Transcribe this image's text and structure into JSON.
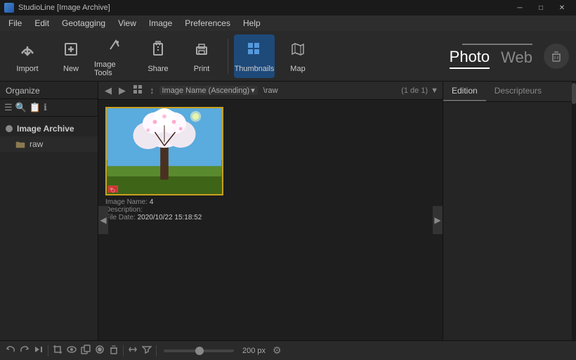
{
  "titlebar": {
    "title": "StudioLine [Image Archive]",
    "icon": "app-icon",
    "controls": {
      "minimize": "─",
      "maximize": "□",
      "close": "✕"
    }
  },
  "menubar": {
    "items": [
      "File",
      "Edit",
      "Geotagging",
      "View",
      "Image",
      "Preferences",
      "Help"
    ]
  },
  "toolbar": {
    "tools": [
      {
        "id": "import",
        "label": "Import",
        "icon": "↩"
      },
      {
        "id": "new",
        "label": "New",
        "icon": "+"
      },
      {
        "id": "image-tools",
        "label": "Image Tools",
        "icon": "✏"
      },
      {
        "id": "share",
        "label": "Share",
        "icon": "⬆"
      },
      {
        "id": "print",
        "label": "Print",
        "icon": "🖨"
      },
      {
        "id": "thumbnails",
        "label": "Thumbnails",
        "icon": "⊞",
        "active": true
      },
      {
        "id": "map",
        "label": "Map",
        "icon": "🗺"
      }
    ],
    "view_tabs": {
      "photo": "Photo",
      "web": "Web"
    },
    "trash_label": "🗑"
  },
  "sidebar": {
    "header": "Organize",
    "tools": [
      "☰",
      "🔍",
      "📋",
      "ℹ"
    ],
    "tree": {
      "root": {
        "label": "Image Archive",
        "icon": "●"
      },
      "children": [
        {
          "label": "raw",
          "icon": "📁"
        }
      ]
    }
  },
  "filterbar": {
    "nav_back": "◀",
    "nav_forward": "▶",
    "view_mode": "⊞",
    "sort_icon": "↕",
    "sort_label": "Image Name (Ascending)",
    "path": "\\raw",
    "count": "(1 de 1)",
    "dropdown_icon": "▼"
  },
  "thumbnail": {
    "border_color": "#c8a020",
    "tag_icon": "🏷",
    "info": {
      "name_label": "Image Name:",
      "name_value": "4",
      "desc_label": "Description:",
      "desc_value": "",
      "date_label": "File Date:",
      "date_value": "2020/10/22 15:18:52"
    }
  },
  "right_panel": {
    "tabs": [
      {
        "label": "Edition",
        "active": true
      },
      {
        "label": "Descripteurs",
        "active": false
      }
    ]
  },
  "bottombar": {
    "icons": [
      "↺",
      "↻",
      "⏭",
      "✂",
      "👁",
      "📋",
      "⏺",
      "🗑",
      "↕",
      "▼"
    ],
    "zoom_value": "200 px",
    "gear": "⚙"
  },
  "scroll_arrows": {
    "left": "◀",
    "right": "▶"
  }
}
